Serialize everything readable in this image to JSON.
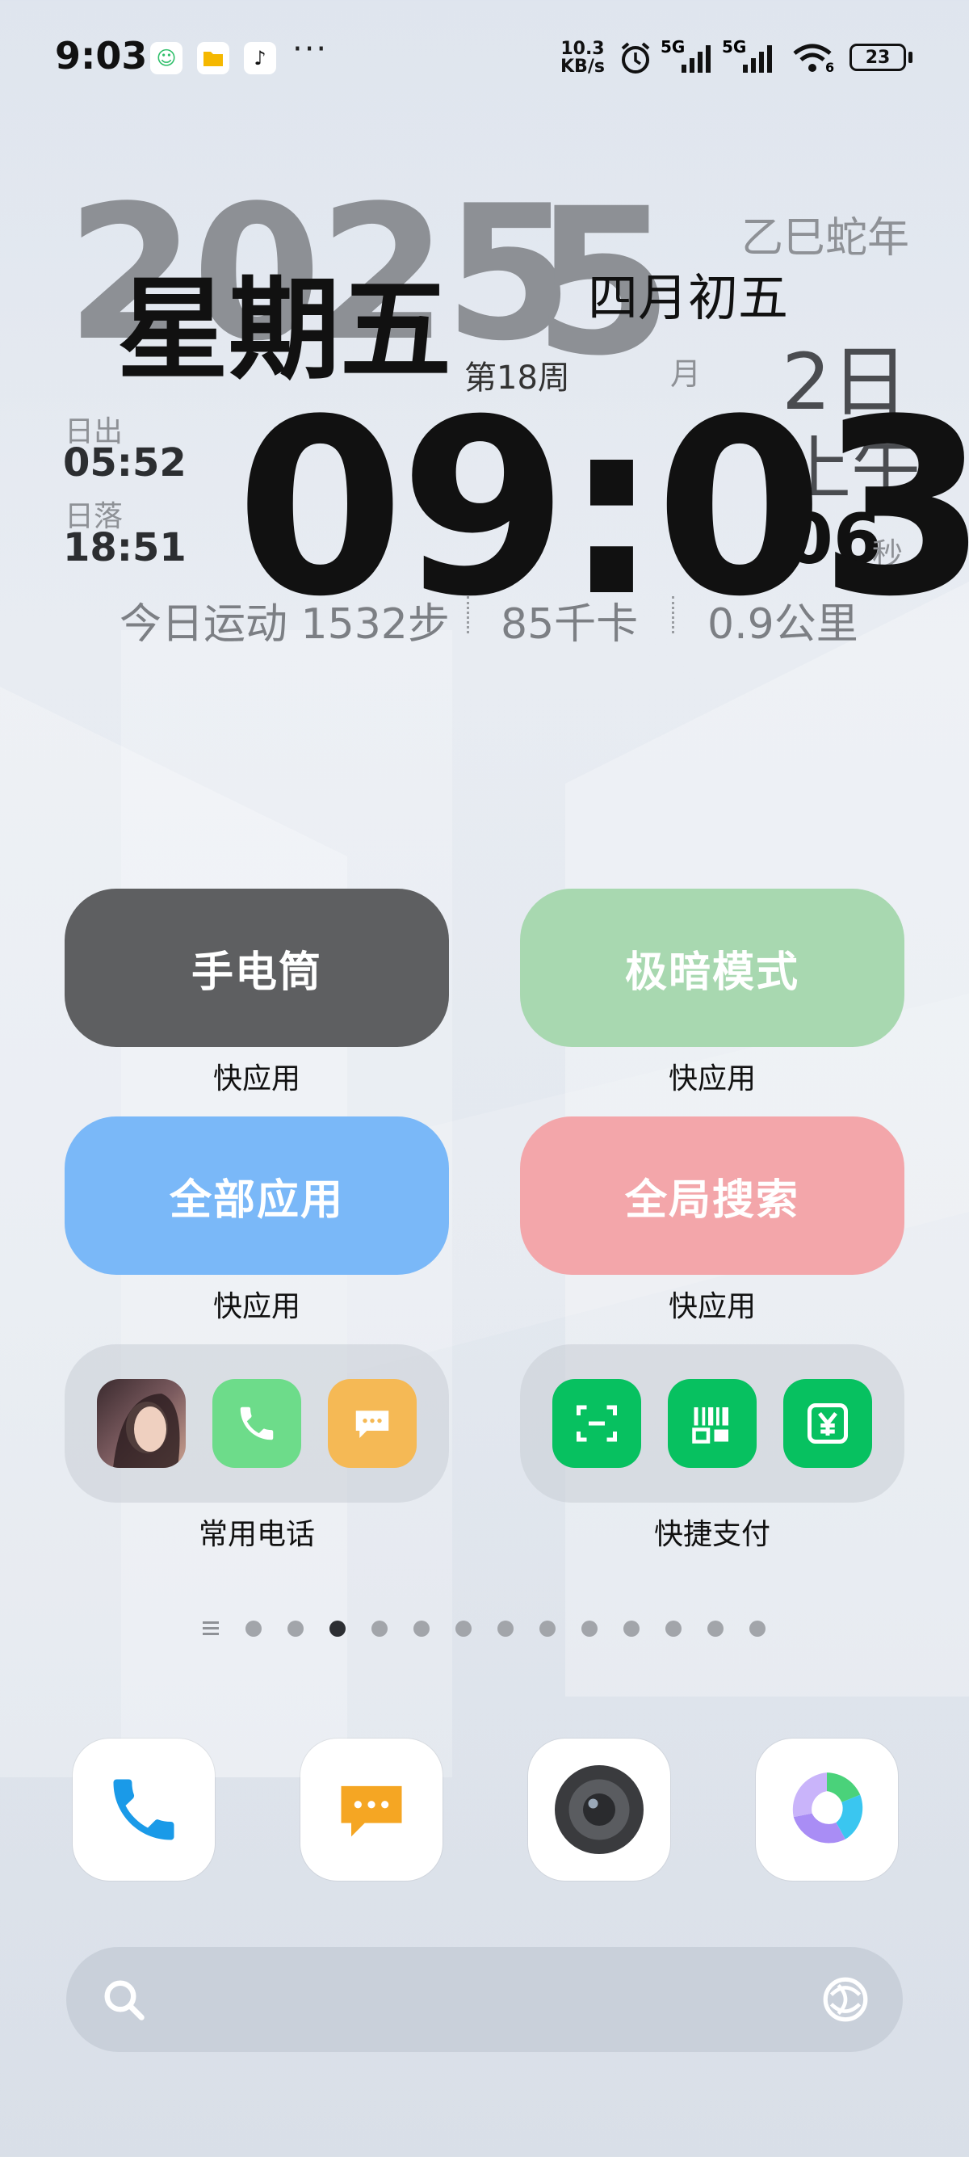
{
  "status_bar": {
    "time": "9:03",
    "more": "···",
    "net_speed_value": "10.3",
    "net_speed_unit": "KB/s",
    "signal1_label": "5G",
    "signal2_label": "5G",
    "wifi_sub": "6",
    "battery": "23"
  },
  "clock_widget": {
    "year": "2025",
    "month_big": "5",
    "weekday": "星期五",
    "week_number": "第18周",
    "month_label": "月",
    "ganzhi_year": "乙巳蛇年",
    "lunar_date": "四月初五",
    "day": "2日",
    "ampm": "上午",
    "seconds": "06",
    "seconds_label": "秒",
    "sunrise_label": "日出",
    "sunrise_time": "05:52",
    "sunset_label": "日落",
    "sunset_time": "18:51",
    "time": "09:03",
    "steps_text": "今日运动 1532步",
    "calories_text": "85千卡",
    "distance_text": "0.9公里"
  },
  "quick_apps": [
    {
      "label": "手电筒",
      "caption": "快应用",
      "color": "#5e5f61"
    },
    {
      "label": "极暗模式",
      "caption": "快应用",
      "color": "#a8d8b0"
    },
    {
      "label": "全部应用",
      "caption": "快应用",
      "color": "#7ab8f8"
    },
    {
      "label": "全局搜索",
      "caption": "快应用",
      "color": "#f3a6aa"
    }
  ],
  "folders": [
    {
      "label": "常用电话",
      "icons": [
        "contact-avatar-icon",
        "phone-icon",
        "message-icon"
      ]
    },
    {
      "label": "快捷支付",
      "icons": [
        "wechat-scan-icon",
        "wechat-paycode-icon",
        "wechat-pay-icon"
      ]
    }
  ],
  "page_indicator": {
    "total_dots": 13,
    "active_index": 2
  },
  "dock": [
    "phone-icon",
    "messages-icon",
    "camera-icon",
    "browser-icon"
  ],
  "colors": {
    "wechat_green": "#07c160",
    "phone_green": "#6ddc8a",
    "message_orange": "#f5b955"
  }
}
